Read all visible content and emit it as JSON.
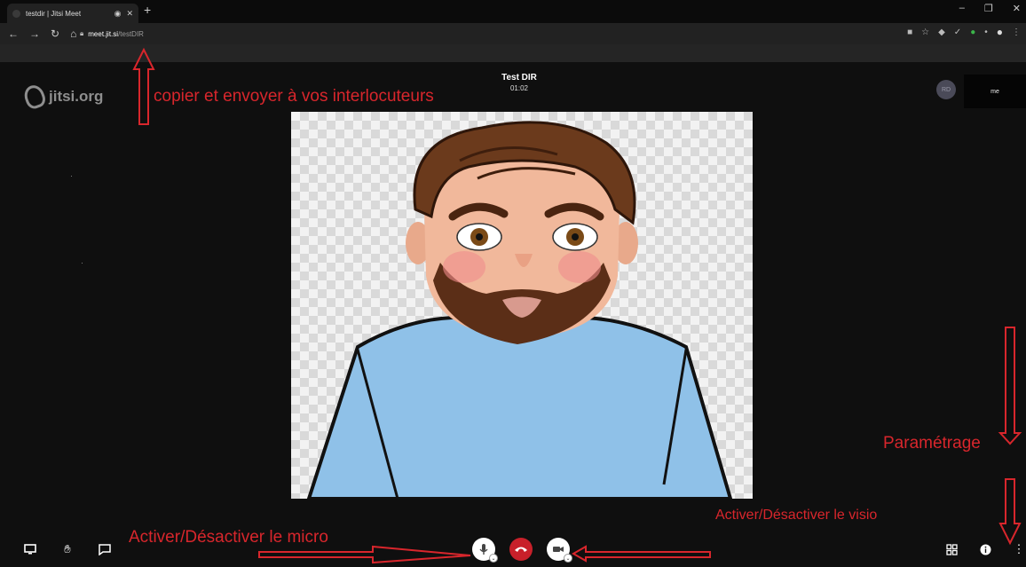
{
  "browser": {
    "tab_title": "testdir | Jitsi Meet",
    "url_host": "meet.jit.si",
    "url_path": "/testDIR"
  },
  "meeting": {
    "logo_text": "jitsi.org",
    "conference_name": "Test DIR",
    "timer": "01:02",
    "participant_initials": "RD",
    "local_label": "me"
  },
  "annotations": {
    "copy_link": "copier et envoyer à vos interlocuteurs",
    "settings": "Paramétrage",
    "toggle_video": "Activer/Désactiver le visio",
    "toggle_mic": "Activer/Désactiver le micro",
    "color": "#d8262c"
  },
  "toolbar": {
    "left": [
      "screen-share-icon",
      "raise-hand-icon",
      "chat-icon"
    ],
    "center": [
      "microphone-icon",
      "hangup-icon",
      "camera-icon"
    ],
    "right": [
      "tile-view-icon",
      "info-icon",
      "more-options-icon"
    ]
  }
}
